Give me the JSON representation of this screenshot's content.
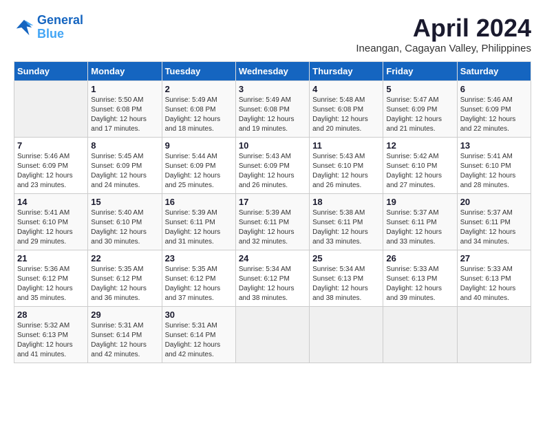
{
  "header": {
    "logo_line1": "General",
    "logo_line2": "Blue",
    "month_title": "April 2024",
    "location": "Ineangan, Cagayan Valley, Philippines"
  },
  "days_of_week": [
    "Sunday",
    "Monday",
    "Tuesday",
    "Wednesday",
    "Thursday",
    "Friday",
    "Saturday"
  ],
  "weeks": [
    [
      {
        "day": "",
        "sunrise": "",
        "sunset": "",
        "daylight": ""
      },
      {
        "day": "1",
        "sunrise": "Sunrise: 5:50 AM",
        "sunset": "Sunset: 6:08 PM",
        "daylight": "Daylight: 12 hours and 17 minutes."
      },
      {
        "day": "2",
        "sunrise": "Sunrise: 5:49 AM",
        "sunset": "Sunset: 6:08 PM",
        "daylight": "Daylight: 12 hours and 18 minutes."
      },
      {
        "day": "3",
        "sunrise": "Sunrise: 5:49 AM",
        "sunset": "Sunset: 6:08 PM",
        "daylight": "Daylight: 12 hours and 19 minutes."
      },
      {
        "day": "4",
        "sunrise": "Sunrise: 5:48 AM",
        "sunset": "Sunset: 6:08 PM",
        "daylight": "Daylight: 12 hours and 20 minutes."
      },
      {
        "day": "5",
        "sunrise": "Sunrise: 5:47 AM",
        "sunset": "Sunset: 6:09 PM",
        "daylight": "Daylight: 12 hours and 21 minutes."
      },
      {
        "day": "6",
        "sunrise": "Sunrise: 5:46 AM",
        "sunset": "Sunset: 6:09 PM",
        "daylight": "Daylight: 12 hours and 22 minutes."
      }
    ],
    [
      {
        "day": "7",
        "sunrise": "Sunrise: 5:46 AM",
        "sunset": "Sunset: 6:09 PM",
        "daylight": "Daylight: 12 hours and 23 minutes."
      },
      {
        "day": "8",
        "sunrise": "Sunrise: 5:45 AM",
        "sunset": "Sunset: 6:09 PM",
        "daylight": "Daylight: 12 hours and 24 minutes."
      },
      {
        "day": "9",
        "sunrise": "Sunrise: 5:44 AM",
        "sunset": "Sunset: 6:09 PM",
        "daylight": "Daylight: 12 hours and 25 minutes."
      },
      {
        "day": "10",
        "sunrise": "Sunrise: 5:43 AM",
        "sunset": "Sunset: 6:09 PM",
        "daylight": "Daylight: 12 hours and 26 minutes."
      },
      {
        "day": "11",
        "sunrise": "Sunrise: 5:43 AM",
        "sunset": "Sunset: 6:10 PM",
        "daylight": "Daylight: 12 hours and 26 minutes."
      },
      {
        "day": "12",
        "sunrise": "Sunrise: 5:42 AM",
        "sunset": "Sunset: 6:10 PM",
        "daylight": "Daylight: 12 hours and 27 minutes."
      },
      {
        "day": "13",
        "sunrise": "Sunrise: 5:41 AM",
        "sunset": "Sunset: 6:10 PM",
        "daylight": "Daylight: 12 hours and 28 minutes."
      }
    ],
    [
      {
        "day": "14",
        "sunrise": "Sunrise: 5:41 AM",
        "sunset": "Sunset: 6:10 PM",
        "daylight": "Daylight: 12 hours and 29 minutes."
      },
      {
        "day": "15",
        "sunrise": "Sunrise: 5:40 AM",
        "sunset": "Sunset: 6:10 PM",
        "daylight": "Daylight: 12 hours and 30 minutes."
      },
      {
        "day": "16",
        "sunrise": "Sunrise: 5:39 AM",
        "sunset": "Sunset: 6:11 PM",
        "daylight": "Daylight: 12 hours and 31 minutes."
      },
      {
        "day": "17",
        "sunrise": "Sunrise: 5:39 AM",
        "sunset": "Sunset: 6:11 PM",
        "daylight": "Daylight: 12 hours and 32 minutes."
      },
      {
        "day": "18",
        "sunrise": "Sunrise: 5:38 AM",
        "sunset": "Sunset: 6:11 PM",
        "daylight": "Daylight: 12 hours and 33 minutes."
      },
      {
        "day": "19",
        "sunrise": "Sunrise: 5:37 AM",
        "sunset": "Sunset: 6:11 PM",
        "daylight": "Daylight: 12 hours and 33 minutes."
      },
      {
        "day": "20",
        "sunrise": "Sunrise: 5:37 AM",
        "sunset": "Sunset: 6:11 PM",
        "daylight": "Daylight: 12 hours and 34 minutes."
      }
    ],
    [
      {
        "day": "21",
        "sunrise": "Sunrise: 5:36 AM",
        "sunset": "Sunset: 6:12 PM",
        "daylight": "Daylight: 12 hours and 35 minutes."
      },
      {
        "day": "22",
        "sunrise": "Sunrise: 5:35 AM",
        "sunset": "Sunset: 6:12 PM",
        "daylight": "Daylight: 12 hours and 36 minutes."
      },
      {
        "day": "23",
        "sunrise": "Sunrise: 5:35 AM",
        "sunset": "Sunset: 6:12 PM",
        "daylight": "Daylight: 12 hours and 37 minutes."
      },
      {
        "day": "24",
        "sunrise": "Sunrise: 5:34 AM",
        "sunset": "Sunset: 6:12 PM",
        "daylight": "Daylight: 12 hours and 38 minutes."
      },
      {
        "day": "25",
        "sunrise": "Sunrise: 5:34 AM",
        "sunset": "Sunset: 6:13 PM",
        "daylight": "Daylight: 12 hours and 38 minutes."
      },
      {
        "day": "26",
        "sunrise": "Sunrise: 5:33 AM",
        "sunset": "Sunset: 6:13 PM",
        "daylight": "Daylight: 12 hours and 39 minutes."
      },
      {
        "day": "27",
        "sunrise": "Sunrise: 5:33 AM",
        "sunset": "Sunset: 6:13 PM",
        "daylight": "Daylight: 12 hours and 40 minutes."
      }
    ],
    [
      {
        "day": "28",
        "sunrise": "Sunrise: 5:32 AM",
        "sunset": "Sunset: 6:13 PM",
        "daylight": "Daylight: 12 hours and 41 minutes."
      },
      {
        "day": "29",
        "sunrise": "Sunrise: 5:31 AM",
        "sunset": "Sunset: 6:14 PM",
        "daylight": "Daylight: 12 hours and 42 minutes."
      },
      {
        "day": "30",
        "sunrise": "Sunrise: 5:31 AM",
        "sunset": "Sunset: 6:14 PM",
        "daylight": "Daylight: 12 hours and 42 minutes."
      },
      {
        "day": "",
        "sunrise": "",
        "sunset": "",
        "daylight": ""
      },
      {
        "day": "",
        "sunrise": "",
        "sunset": "",
        "daylight": ""
      },
      {
        "day": "",
        "sunrise": "",
        "sunset": "",
        "daylight": ""
      },
      {
        "day": "",
        "sunrise": "",
        "sunset": "",
        "daylight": ""
      }
    ]
  ]
}
